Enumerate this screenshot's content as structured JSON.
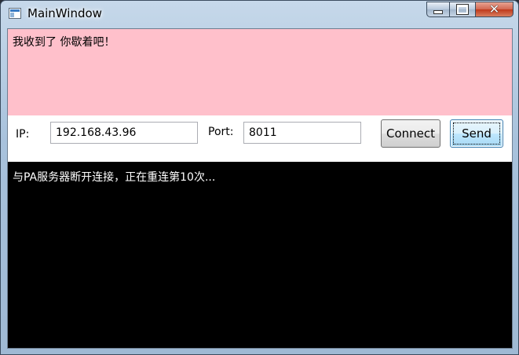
{
  "window": {
    "title": "MainWindow",
    "controls": {
      "minimize": "minimize-icon",
      "maximize": "maximize-icon",
      "close": "close-icon"
    }
  },
  "received": {
    "text": "我收到了 你歇着吧！",
    "background": "#ffc0cb"
  },
  "connection": {
    "ip_label": "IP:",
    "ip_value": "192.168.43.96",
    "port_label": "Port:",
    "port_value": "8011",
    "connect_label": "Connect",
    "send_label": "Send"
  },
  "log": {
    "text": "与PA服务器断开连接，正在重连第10次...",
    "background": "#000000",
    "color": "#ffffff"
  }
}
